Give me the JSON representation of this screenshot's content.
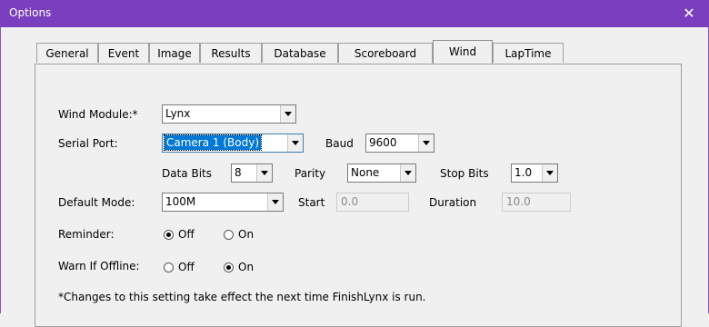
{
  "window": {
    "title": "Options",
    "close_glyph": "✕"
  },
  "tabs": [
    {
      "label": "General"
    },
    {
      "label": "Event"
    },
    {
      "label": "Image"
    },
    {
      "label": "Results"
    },
    {
      "label": "Database"
    },
    {
      "label": "Scoreboard"
    },
    {
      "label": "Wind",
      "active": true
    },
    {
      "label": "LapTime"
    }
  ],
  "wind_module": {
    "label": "Wind Module:*",
    "value": "Lynx"
  },
  "serial_port": {
    "label": "Serial Port:",
    "value": "Camera 1 (Body)"
  },
  "baud": {
    "label": "Baud",
    "value": "9600"
  },
  "data_bits": {
    "label": "Data Bits",
    "value": "8"
  },
  "parity": {
    "label": "Parity",
    "value": "None"
  },
  "stop_bits": {
    "label": "Stop Bits",
    "value": "1.0"
  },
  "default_mode": {
    "label": "Default Mode:",
    "value": "100M"
  },
  "start": {
    "label": "Start",
    "value": "0.0"
  },
  "duration": {
    "label": "Duration",
    "value": "10.0"
  },
  "reminder": {
    "label": "Reminder:",
    "off_label": "Off",
    "on_label": "On",
    "selected": "off"
  },
  "warn_offline": {
    "label": "Warn If Offline:",
    "off_label": "Off",
    "on_label": "On",
    "selected": "on"
  },
  "footnote": "*Changes to this setting take effect the next time FinishLynx is run."
}
